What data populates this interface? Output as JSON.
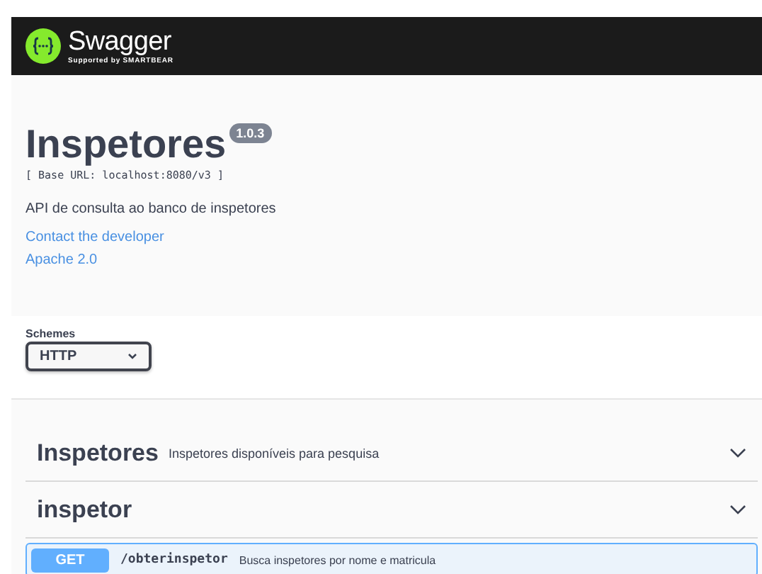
{
  "topbar": {
    "brand": "Swagger",
    "tagline": "Supported by SMARTBEAR"
  },
  "info": {
    "title": "Inspetores",
    "version": "1.0.3",
    "base_url": "[ Base URL: localhost:8080/v3 ]",
    "description": "API de consulta ao banco de inspetores",
    "links": [
      "Contact the developer",
      "Apache 2.0"
    ]
  },
  "schemes": {
    "label": "Schemes",
    "value": "HTTP"
  },
  "tags": [
    {
      "name": "Inspetores",
      "description": "Inspetores disponíveis para pesquisa"
    },
    {
      "name": "inspetor",
      "operations": [
        {
          "method": "GET",
          "path": "/obterinspetor",
          "summary": "Busca inspetores por nome e matricula"
        }
      ]
    }
  ]
}
